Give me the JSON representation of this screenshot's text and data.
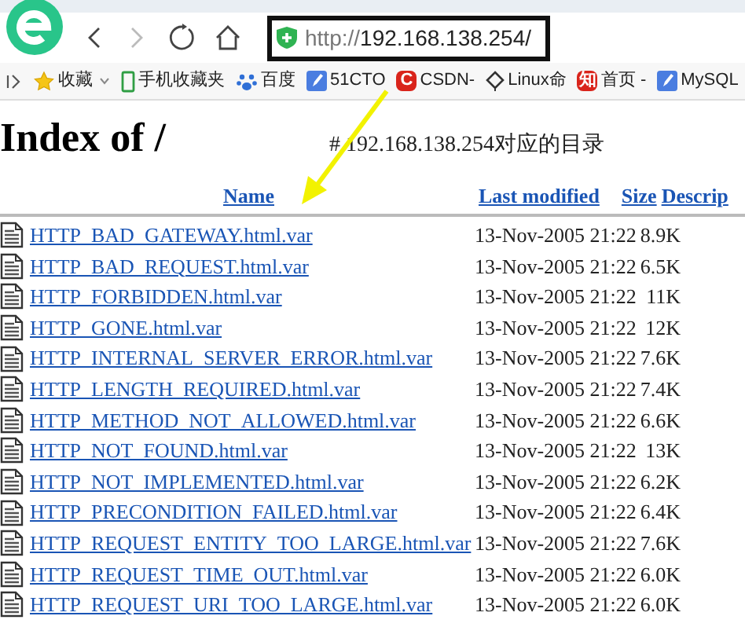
{
  "address_bar": {
    "url_scheme": "http://",
    "url_host": "192.168.138.254/"
  },
  "bookmarks": [
    {
      "kind": "star",
      "label": "收藏"
    },
    {
      "kind": "phone",
      "label": "手机收藏夹"
    },
    {
      "kind": "paw",
      "label": "百度"
    },
    {
      "kind": "pen",
      "label": "51CTO"
    },
    {
      "kind": "letter",
      "glyph": "C",
      "label": "CSDN-"
    },
    {
      "kind": "diamond",
      "label": "Linux命"
    },
    {
      "kind": "letter",
      "glyph": "知",
      "label": "首页 -"
    },
    {
      "kind": "pen",
      "label": "MySQL"
    }
  ],
  "heading": "Index of /",
  "annotation": "# 192.168.138.254对应的目录",
  "table": {
    "columns": [
      "Name",
      "Last modified",
      "Size",
      "Descrip"
    ],
    "rows": [
      {
        "name": "HTTP_BAD_GATEWAY.html.var",
        "modified": "13-Nov-2005 21:22",
        "size": "8.9K"
      },
      {
        "name": "HTTP_BAD_REQUEST.html.var",
        "modified": "13-Nov-2005 21:22",
        "size": "6.5K"
      },
      {
        "name": "HTTP_FORBIDDEN.html.var",
        "modified": "13-Nov-2005 21:22",
        "size": "11K"
      },
      {
        "name": "HTTP_GONE.html.var",
        "modified": "13-Nov-2005 21:22",
        "size": "12K"
      },
      {
        "name": "HTTP_INTERNAL_SERVER_ERROR.html.var",
        "modified": "13-Nov-2005 21:22",
        "size": "7.6K"
      },
      {
        "name": "HTTP_LENGTH_REQUIRED.html.var",
        "modified": "13-Nov-2005 21:22",
        "size": "7.4K"
      },
      {
        "name": "HTTP_METHOD_NOT_ALLOWED.html.var",
        "modified": "13-Nov-2005 21:22",
        "size": "6.6K"
      },
      {
        "name": "HTTP_NOT_FOUND.html.var",
        "modified": "13-Nov-2005 21:22",
        "size": "13K"
      },
      {
        "name": "HTTP_NOT_IMPLEMENTED.html.var",
        "modified": "13-Nov-2005 21:22",
        "size": "6.2K"
      },
      {
        "name": "HTTP_PRECONDITION_FAILED.html.var",
        "modified": "13-Nov-2005 21:22",
        "size": "6.4K"
      },
      {
        "name": "HTTP_REQUEST_ENTITY_TOO_LARGE.html.var",
        "modified": "13-Nov-2005 21:22",
        "size": "7.6K"
      },
      {
        "name": "HTTP_REQUEST_TIME_OUT.html.var",
        "modified": "13-Nov-2005 21:22",
        "size": "6.0K"
      },
      {
        "name": "HTTP_REQUEST_URI_TOO_LARGE.html.var",
        "modified": "13-Nov-2005 21:22",
        "size": "6.0K"
      }
    ]
  }
}
